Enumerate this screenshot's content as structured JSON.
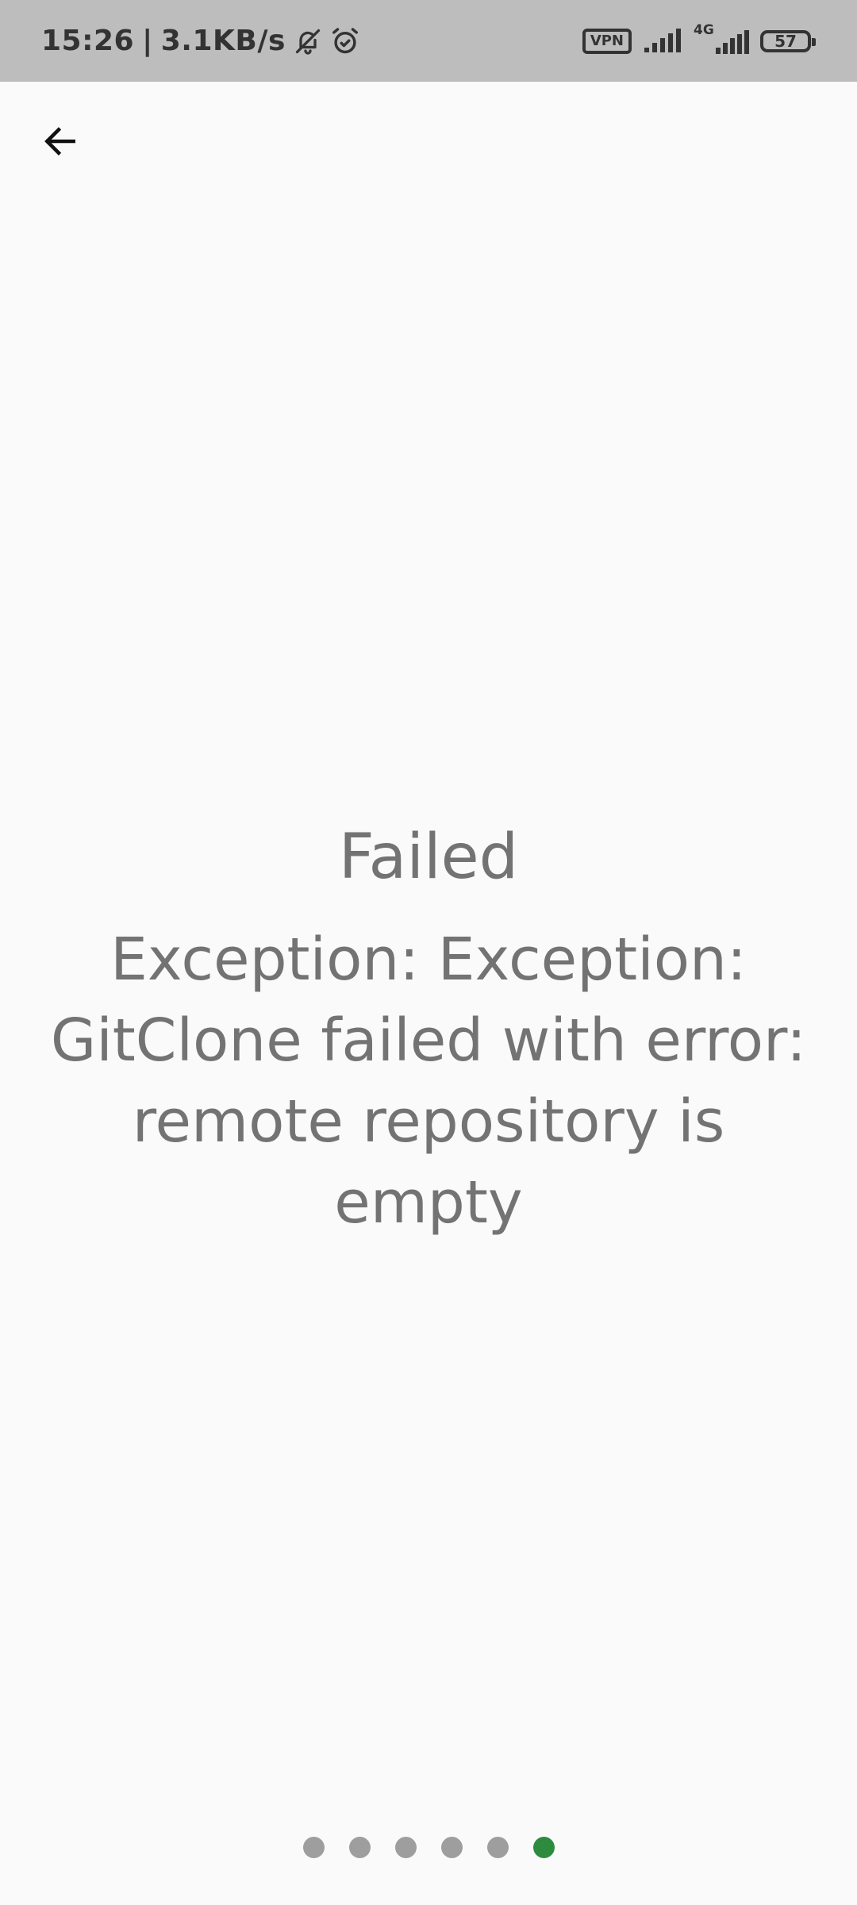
{
  "status_bar": {
    "time": "15:26",
    "separator": "|",
    "network_speed": "3.1KB/s",
    "vpn_label": "VPN",
    "network_type": "4G",
    "battery_level": "57",
    "icons": [
      "bell-muted-icon",
      "alarm-icon",
      "vpn-icon",
      "signal-icon",
      "signal-4g-icon",
      "battery-icon"
    ]
  },
  "header": {
    "back_icon": "arrow-left-icon"
  },
  "main": {
    "title": "Failed",
    "message": "Exception: Exception: GitClone failed with error: remote repository is empty"
  },
  "pager": {
    "total": 6,
    "active_index": 5,
    "active_color": "#2e8b3e",
    "inactive_color": "#9e9e9e"
  }
}
